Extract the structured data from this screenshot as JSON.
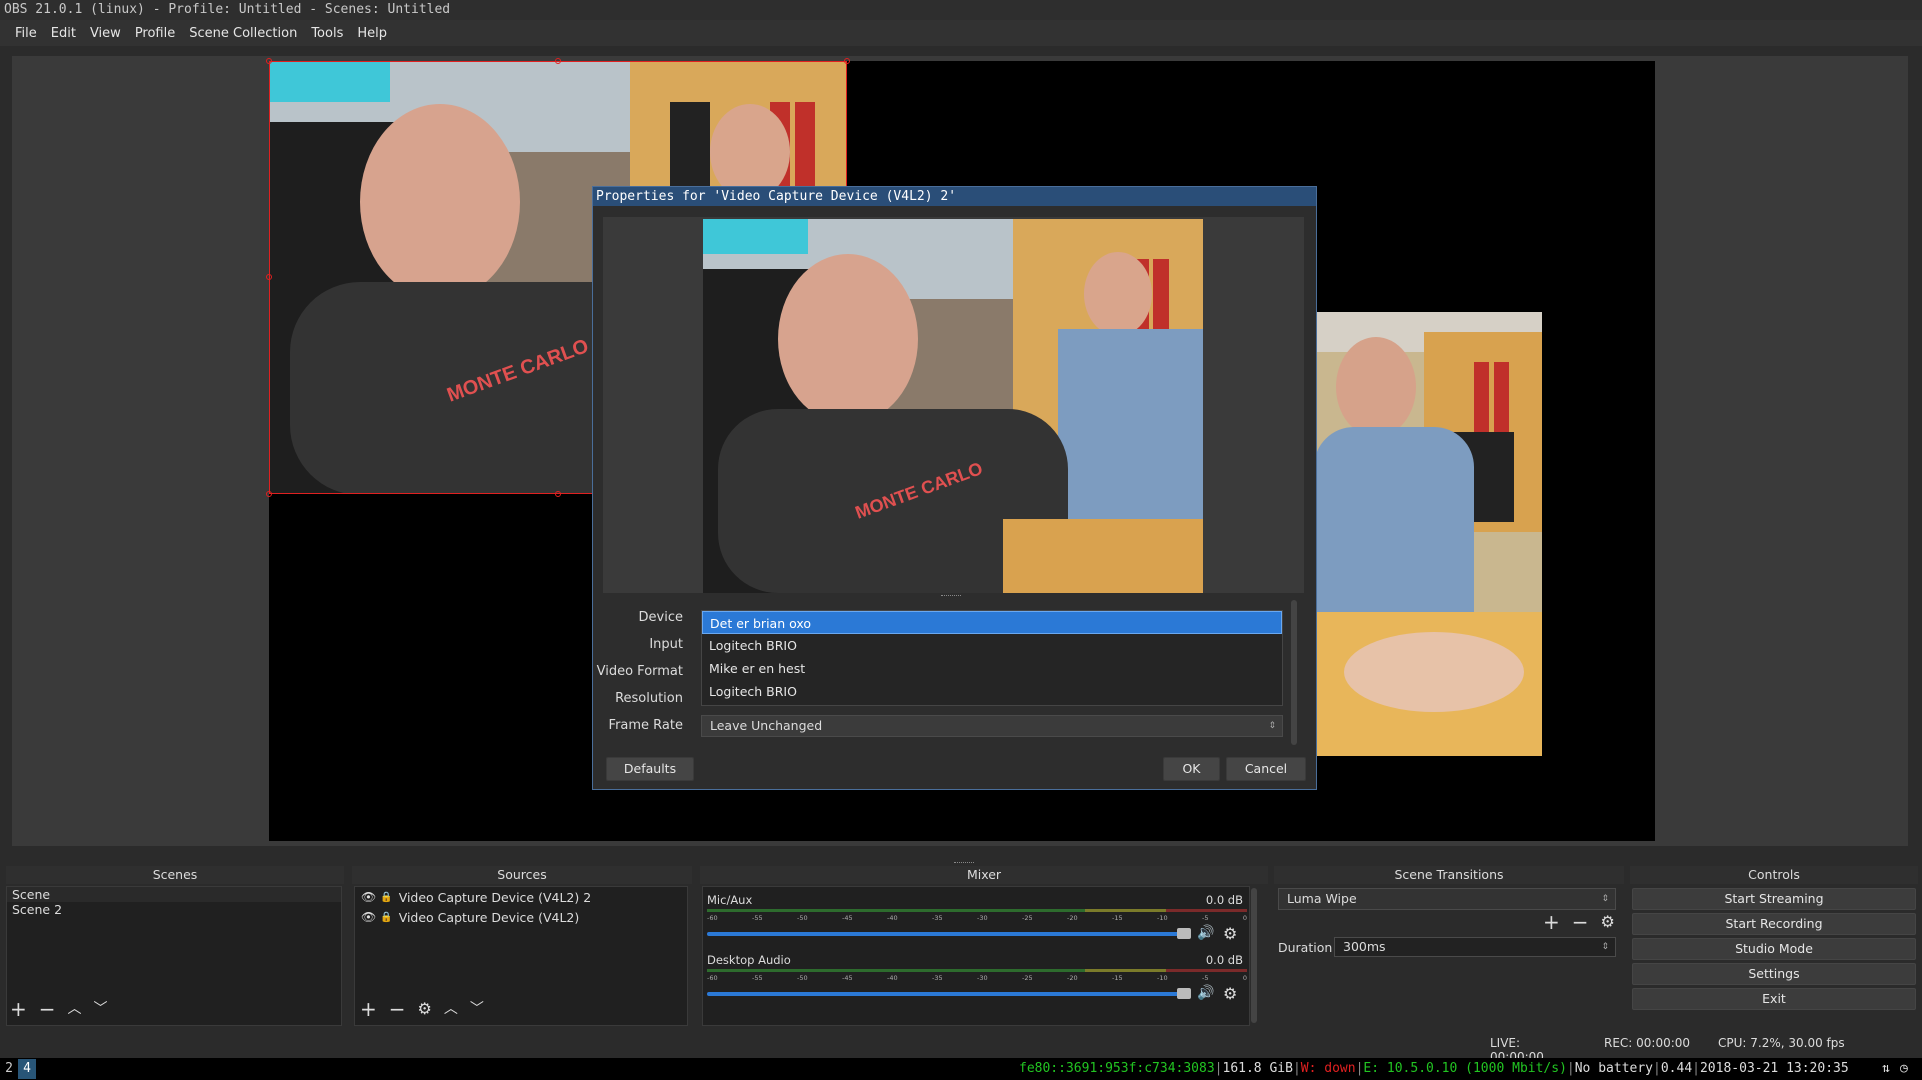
{
  "window": {
    "title": "OBS 21.0.1 (linux) - Profile: Untitled - Scenes: Untitled"
  },
  "menu": [
    {
      "label": "File"
    },
    {
      "label": "Edit"
    },
    {
      "label": "View"
    },
    {
      "label": "Profile"
    },
    {
      "label": "Scene Collection"
    },
    {
      "label": "Tools"
    },
    {
      "label": "Help"
    }
  ],
  "dialog": {
    "title": "Properties for 'Video Capture Device (V4L2) 2'",
    "labels": {
      "device": "Device",
      "input": "Input",
      "video_format": "Video Format",
      "resolution": "Resolution",
      "frame_rate": "Frame Rate"
    },
    "device_options": [
      "Det er brian oxo",
      "Logitech BRIO",
      "Mike er en hest",
      "Logitech BRIO"
    ],
    "frame_rate_value": "Leave Unchanged",
    "buttons": {
      "defaults": "Defaults",
      "ok": "OK",
      "cancel": "Cancel"
    }
  },
  "docks": {
    "scenes": {
      "header": "Scenes",
      "items": [
        "Scene",
        "Scene 2"
      ]
    },
    "sources": {
      "header": "Sources",
      "items": [
        "Video Capture Device (V4L2) 2",
        "Video Capture Device (V4L2)"
      ]
    },
    "mixer": {
      "header": "Mixer",
      "channels": [
        {
          "name": "Mic/Aux",
          "db": "0.0 dB"
        },
        {
          "name": "Desktop Audio",
          "db": "0.0 dB"
        }
      ],
      "ticks": [
        "-60",
        "-55",
        "-50",
        "-45",
        "-40",
        "-35",
        "-30",
        "-25",
        "-20",
        "-15",
        "-10",
        "-5",
        "0"
      ]
    },
    "transitions": {
      "header": "Scene Transitions",
      "selected": "Luma Wipe",
      "duration_label": "Duration",
      "duration_value": "300ms"
    },
    "controls": {
      "header": "Controls",
      "buttons": [
        "Start Streaming",
        "Start Recording",
        "Studio Mode",
        "Settings",
        "Exit"
      ]
    }
  },
  "status": {
    "live": "LIVE: 00:00:00",
    "rec": "REC: 00:00:00",
    "cpu": "CPU: 7.2%, 30.00 fps"
  },
  "taskbar": {
    "workspaces": [
      "2",
      "4"
    ],
    "active_workspace": "4",
    "ipv6": "fe80::3691:953f:c734:3083",
    "disk": "161.8 GiB",
    "wifi": "W: down",
    "eth": "E: 10.5.0.10 (1000 Mbit/s)",
    "battery": "No battery",
    "load": "0.44",
    "datetime": "2018-03-21 13:20:35"
  },
  "colors": {
    "accent": "#2b79d6",
    "dialog_title": "#2a4e78",
    "selection": "#e02020"
  }
}
